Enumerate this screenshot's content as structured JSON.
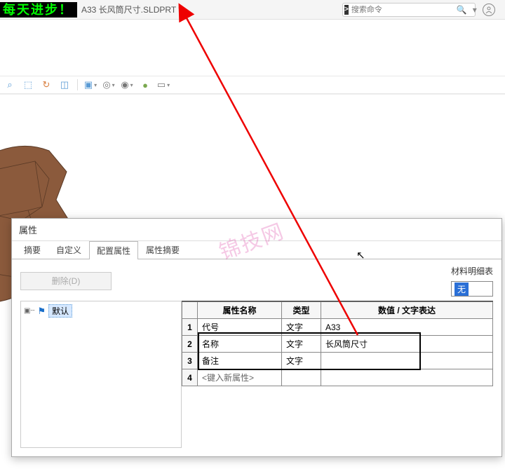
{
  "banner_text": "每天进步！",
  "file_title": "A33 长风筒尺寸.SLDPRT *",
  "search_placeholder": "搜索命令",
  "props": {
    "window_title": "属性",
    "tabs": {
      "summary": "摘要",
      "custom": "自定义",
      "config": "配置属性",
      "prop_summary": "属性摘要"
    },
    "delete_btn": "删除(D)",
    "bom_label": "材料明细表",
    "bom_value": "无",
    "tree_default": "默认",
    "headers": {
      "name": "属性名称",
      "type": "类型",
      "value": "数值 / 文字表达"
    },
    "rows": [
      {
        "num": "1",
        "name": "代号",
        "type": "文字",
        "value": "A33"
      },
      {
        "num": "2",
        "name": "名称",
        "type": "文字",
        "value": "长风筒尺寸"
      },
      {
        "num": "3",
        "name": "备注",
        "type": "文字",
        "value": ""
      },
      {
        "num": "4",
        "name": "<键入新属性>",
        "type": "",
        "value": ""
      }
    ]
  },
  "watermark": "锦技网"
}
